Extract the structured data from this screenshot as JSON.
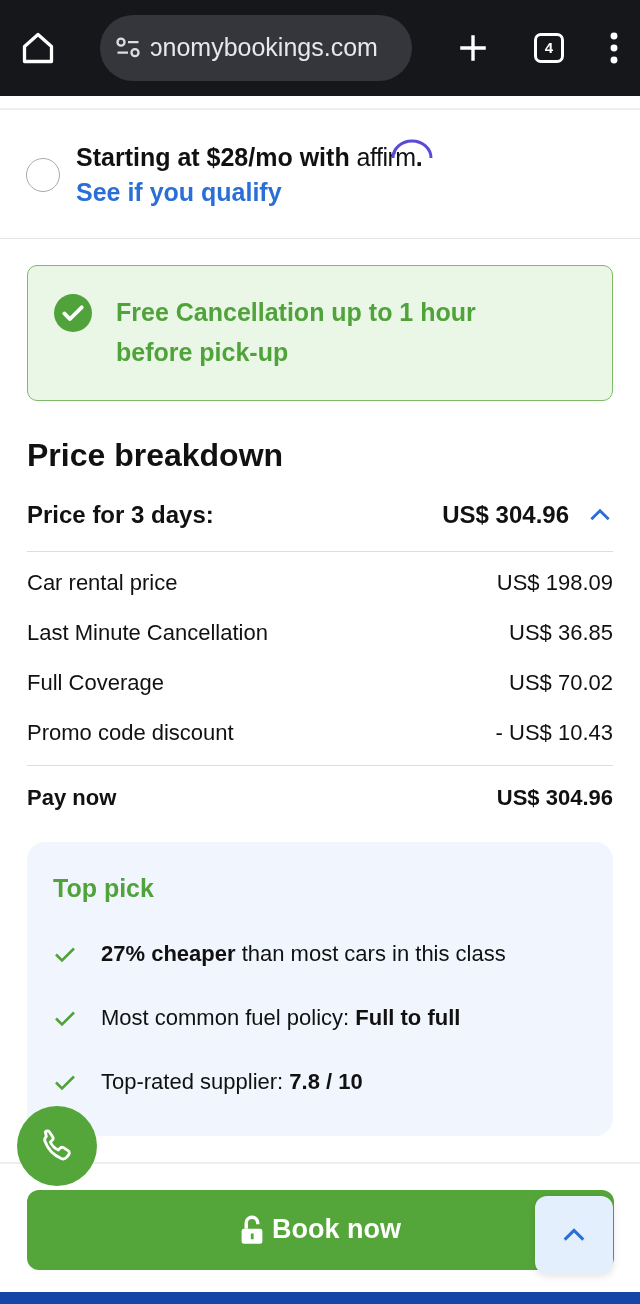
{
  "browser": {
    "url": "ɔnomybookings.com",
    "tab_count": "4"
  },
  "affirm": {
    "selected": false,
    "text_before": "Starting at $28/mo with ",
    "logo": "affirm",
    "text_after": ". ",
    "link": "See if you qualify"
  },
  "cancellation": {
    "text": "Free Cancellation up to 1 hour before pick-up"
  },
  "price_breakdown": {
    "title": "Price breakdown",
    "summary_label": "Price for 3 days:",
    "summary_value": "US$ 304.96",
    "expanded": true,
    "items": [
      {
        "label": "Car rental price",
        "value": "US$ 198.09"
      },
      {
        "label": "Last Minute Cancellation",
        "value": "US$ 36.85"
      },
      {
        "label": "Full Coverage",
        "value": "US$ 70.02"
      },
      {
        "label": "Promo code discount",
        "value": "- US$ 10.43"
      }
    ],
    "total_label": "Pay now",
    "total_value": "US$ 304.96"
  },
  "top_pick": {
    "title": "Top pick",
    "points": [
      "**27% cheaper** than most cars in this class",
      "Most common fuel policy: **Full to full**",
      "Top-rated supplier: **7.8 / 10**"
    ]
  },
  "book_button": "Book now"
}
